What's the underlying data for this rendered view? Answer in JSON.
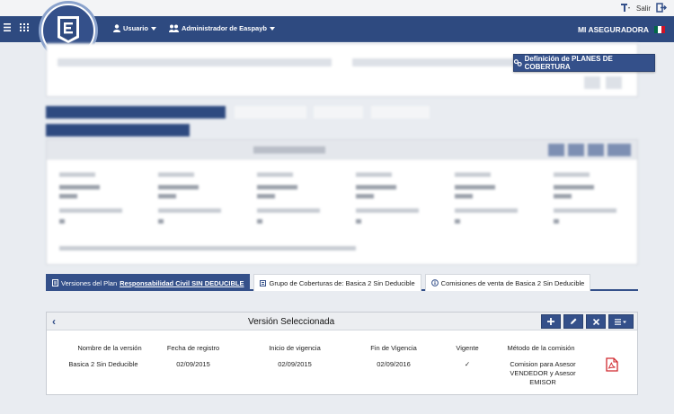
{
  "topbar": {
    "exit_label": "Salir"
  },
  "navbar": {
    "user_menu": "Usuario",
    "admin_menu": "Administrador de Easpayb",
    "brand": "MI ASEGURADORA",
    "flag_colors": [
      "#006847",
      "#ffffff",
      "#ce1126"
    ]
  },
  "definition_button": {
    "label": "Definición de PLANES DE COBERTURA"
  },
  "tabs": [
    {
      "prefix": "Versiones del Plan ",
      "link": "Responsabilidad Civil SIN DEDUCIBLE",
      "icon": "document-icon"
    },
    {
      "label": "Grupo de Coberturas de: Basica 2 Sin Deducible",
      "icon": "list-icon"
    },
    {
      "label": "Comisiones de venta de Basica 2 Sin Deducible",
      "icon": "info-icon"
    }
  ],
  "version_panel": {
    "title": "Versión Seleccionada",
    "columns": [
      "Nombre de la versión",
      "Fecha de registro",
      "Inicio de vigencia",
      "Fin de Vigencia",
      "Vigente",
      "Método de la comisión"
    ],
    "row": {
      "name": "Basica 2 Sin Deducible",
      "registered": "02/09/2015",
      "start": "02/09/2015",
      "end": "02/09/2016",
      "active": "✓",
      "method_lines": [
        "Comision para Asesor",
        "VENDEDOR y Asesor",
        "EMISOR"
      ]
    }
  },
  "colors": {
    "primary": "#34508a",
    "navbar": "#2e4a80",
    "pdf": "#d0282e"
  }
}
